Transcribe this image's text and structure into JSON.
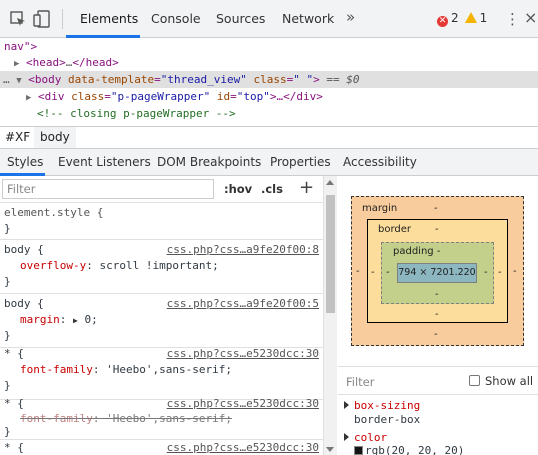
{
  "toolbar": {
    "tabs": [
      "Elements",
      "Console",
      "Sources",
      "Network"
    ],
    "more_tabs_icon": "chevron-double-right",
    "errors_count": "2",
    "warnings_count": "1"
  },
  "dom": {
    "lines": {
      "l0": "nav\">",
      "l1_tag_open": "<head>",
      "l1_ellipsis": "…",
      "l1_tag_close": "</head>",
      "l2_prefix": "…",
      "l2_tag": "<body",
      "l2_attr1": " data-template",
      "l2_val1": "\"thread_view\"",
      "l2_attr2": " class",
      "l2_val2": "\" \"",
      "l2_close": ">",
      "l2_eq": " == $0",
      "l3_tag": "<div",
      "l3_attr1": " class",
      "l3_val1": "\"p-pageWrapper\"",
      "l3_attr2": " id",
      "l3_val2": "\"top\"",
      "l3_close": ">…</div>",
      "l4_comment": "<!-- closing p-pageWrapper -->"
    }
  },
  "breadcrumbs": [
    "#XF",
    "body"
  ],
  "subtabs": [
    "Styles",
    "Event Listeners",
    "DOM Breakpoints",
    "Properties",
    "Accessibility"
  ],
  "styles": {
    "filter_placeholder": "Filter",
    "hov": ":hov",
    "cls": ".cls",
    "plus": "+",
    "rules": [
      {
        "selector": "element.style {",
        "close": "}"
      },
      {
        "selector": "body {",
        "source": "css.php?css…a9fe20f00:8",
        "prop": "overflow-y",
        "value": " scroll !important;",
        "close": "}"
      },
      {
        "selector": "body {",
        "source": "css.php?css…a9fe20f00:5",
        "prop": "margin",
        "value": " 0;",
        "close": "}"
      },
      {
        "selector": "* {",
        "source": "css.php?css…e5230dcc:30",
        "prop": "font-family",
        "value": " 'Heebo',sans-serif;",
        "close": "}"
      },
      {
        "selector": "* {",
        "source": "css.php?css…e5230dcc:30",
        "prop": "font-family",
        "value": " 'Heebo',sans-serif;",
        "close": "}"
      },
      {
        "selector": "* {",
        "source": "css.php?css…e5230dcc:30"
      }
    ]
  },
  "box_model": {
    "margin_label": "margin",
    "border_label": "border",
    "padding_label": "padding",
    "dash": "-",
    "content_size": "794 × 7201.220"
  },
  "computed": {
    "filter_placeholder": "Filter",
    "show_all": "Show all",
    "props": [
      {
        "name": "box-sizing",
        "value": "border-box"
      },
      {
        "name": "color",
        "value": "rgb(20, 20, 20)"
      }
    ]
  },
  "colors": {
    "accent": "#1a73e8",
    "error": "#e53935",
    "warning": "#f4b400",
    "margin_box": "#f9cc9d",
    "border_box": "#fddd9b",
    "padding_box": "#c3d08b",
    "content_box": "#8cb6c0"
  }
}
